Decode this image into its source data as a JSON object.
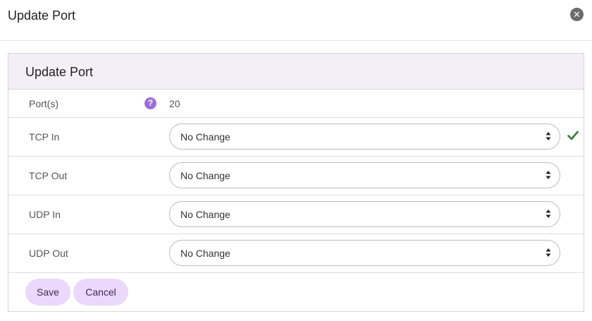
{
  "dialog": {
    "title": "Update Port",
    "close_icon": "close-icon"
  },
  "card": {
    "title": "Update Port",
    "ports": {
      "label": "Port(s)",
      "help_icon": "question-circle-icon",
      "value": "20"
    },
    "fields": [
      {
        "label": "TCP In",
        "selected": "No Change",
        "validated": true
      },
      {
        "label": "TCP Out",
        "selected": "No Change",
        "validated": false
      },
      {
        "label": "UDP In",
        "selected": "No Change",
        "validated": false
      },
      {
        "label": "UDP Out",
        "selected": "No Change",
        "validated": false
      }
    ],
    "buttons": {
      "save_label": "Save",
      "cancel_label": "Cancel"
    }
  },
  "colors": {
    "header_bg": "#f4eff6",
    "button_bg": "#ead9fb",
    "help_icon": "#9b6ddb",
    "check": "#2e7d32"
  }
}
